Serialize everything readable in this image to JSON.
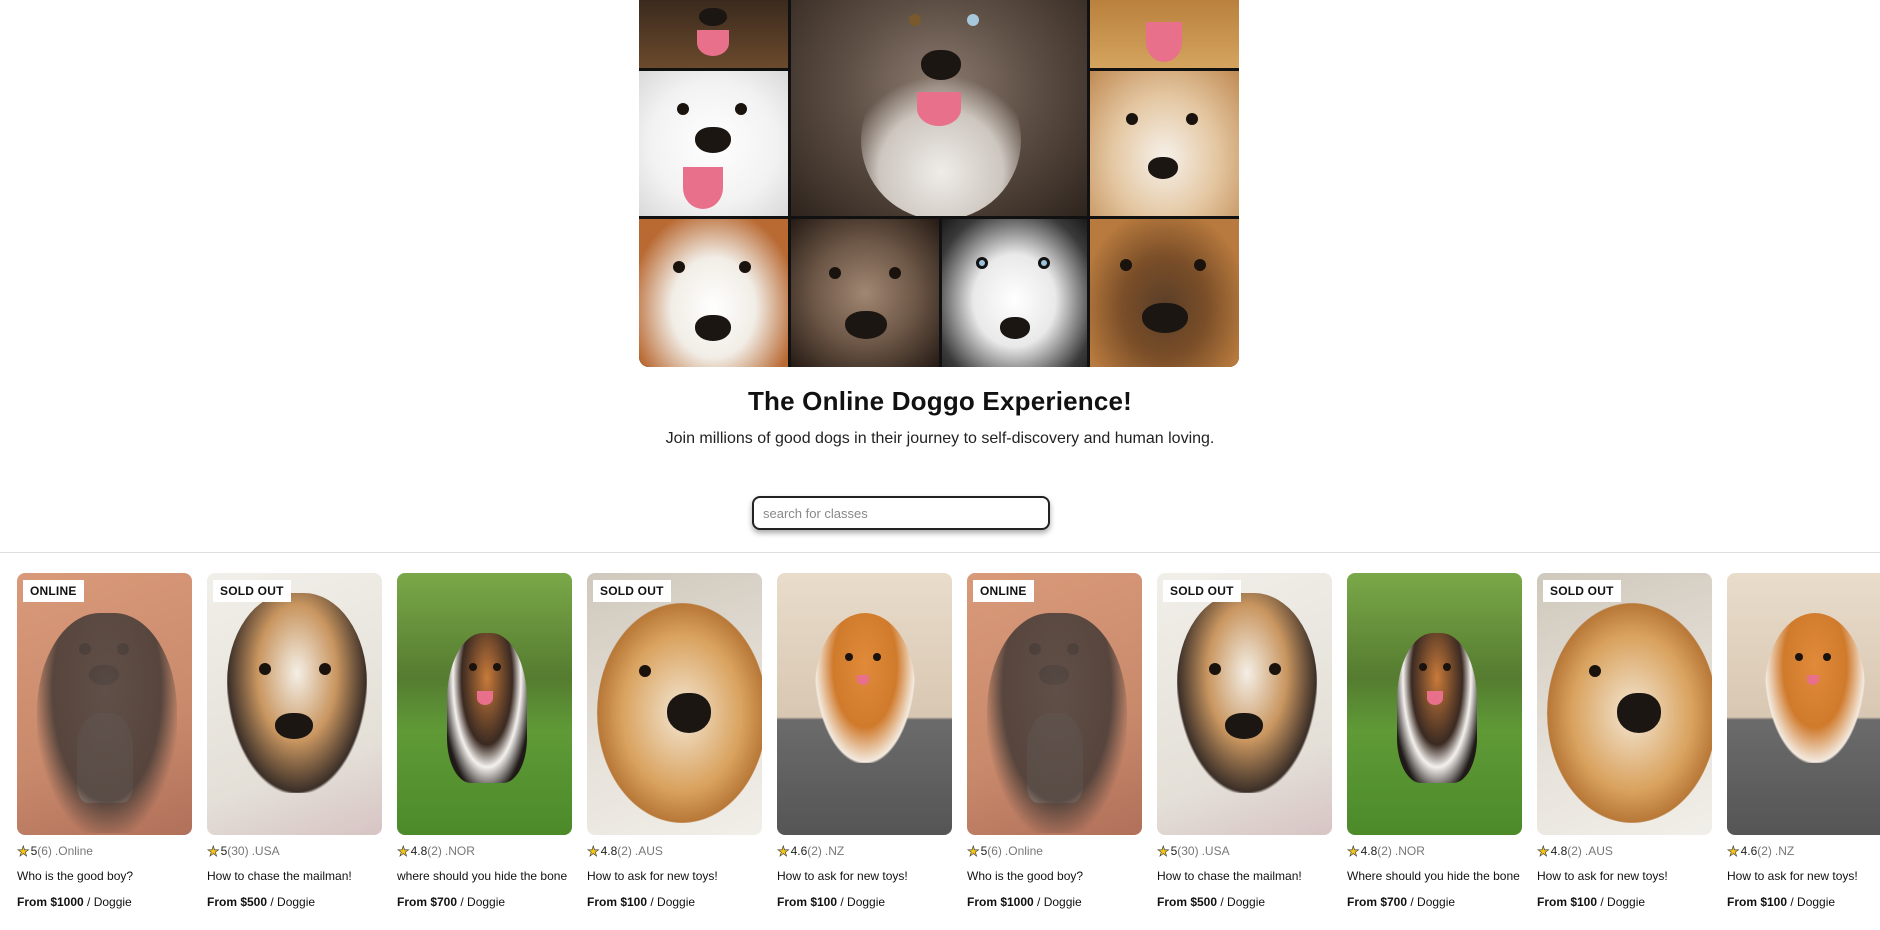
{
  "hero": {
    "title": "The Online Doggo Experience!",
    "subtitle": "Join millions of good dogs in their journey to self-discovery and human loving."
  },
  "search": {
    "placeholder": "search for classes"
  },
  "cards": [
    {
      "badge": "ONLINE",
      "rating": "5",
      "count": "(6)",
      "location": ".Online",
      "title": "Who is the good boy?",
      "price": "From $1000",
      "unit": " / Doggie",
      "art": "pit"
    },
    {
      "badge": "SOLD OUT",
      "rating": "5",
      "count": "(30)",
      "location": ".USA",
      "title": "How to chase the mailman!",
      "price": "From $500",
      "unit": " / Doggie",
      "art": "beagle"
    },
    {
      "badge": "",
      "rating": "4.8",
      "count": "(2)",
      "location": ".NOR",
      "title": "where should you hide the bone",
      "price": "From $700",
      "unit": " / Doggie",
      "art": "corgi"
    },
    {
      "badge": "SOLD OUT",
      "rating": "4.8",
      "count": "(2)",
      "location": ".AUS",
      "title": "How to ask for new toys!",
      "price": "From $100",
      "unit": " / Doggie",
      "art": "golden"
    },
    {
      "badge": "",
      "rating": "4.6",
      "count": "(2)",
      "location": ".NZ",
      "title": "How to ask for new toys!",
      "price": "From $100",
      "unit": " / Doggie",
      "art": "pom"
    },
    {
      "badge": "ONLINE",
      "rating": "5",
      "count": "(6)",
      "location": ".Online",
      "title": "Who is the good boy?",
      "price": "From $1000",
      "unit": " / Doggie",
      "art": "pit"
    },
    {
      "badge": "SOLD OUT",
      "rating": "5",
      "count": "(30)",
      "location": ".USA",
      "title": "How to chase the mailman!",
      "price": "From $500",
      "unit": " / Doggie",
      "art": "beagle"
    },
    {
      "badge": "",
      "rating": "4.8",
      "count": "(2)",
      "location": ".NOR",
      "title": "Where should you hide the bone",
      "price": "From $700",
      "unit": " / Doggie",
      "art": "corgi"
    },
    {
      "badge": "SOLD OUT",
      "rating": "4.8",
      "count": "(2)",
      "location": ".AUS",
      "title": "How to ask for new toys!",
      "price": "From $100",
      "unit": " / Doggie",
      "art": "golden"
    },
    {
      "badge": "",
      "rating": "4.6",
      "count": "(2)",
      "location": ".NZ",
      "title": "How to ask for new toys!",
      "price": "From $100",
      "unit": " / Doggie",
      "art": "pom"
    }
  ],
  "colors": {
    "star": "#f5c518",
    "badge_bg": "#ffffff",
    "text": "#111111"
  },
  "icons": {
    "rating": "star-icon"
  }
}
